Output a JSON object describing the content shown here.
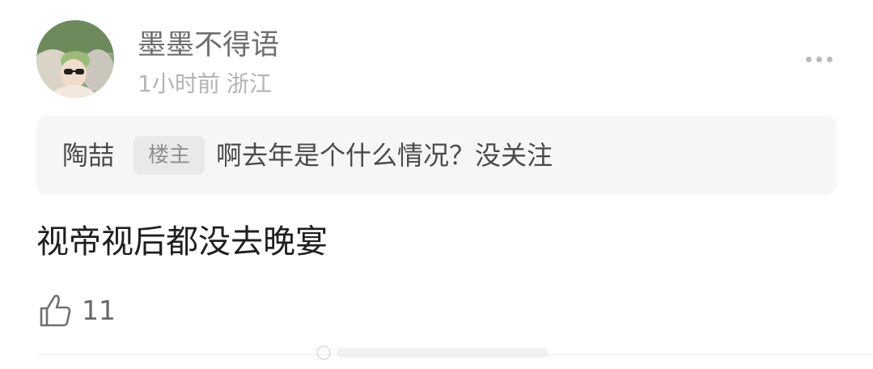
{
  "post": {
    "username": "墨墨不得语",
    "time": "1小时前",
    "location": "浙江",
    "quote": {
      "author": "陶喆",
      "badge": "楼主",
      "text": "啊去年是个什么情况？没关注"
    },
    "content": "视帝视后都没去晚宴",
    "likes": "11"
  },
  "icons": {
    "more": "more-dots-icon",
    "like": "thumbs-up-icon"
  },
  "colors": {
    "username": "#6e6e6e",
    "meta": "#b4b4b4",
    "quote_background": "#f6f6f6",
    "badge_background": "#e9e9e9",
    "text": "#1f1f1f"
  }
}
